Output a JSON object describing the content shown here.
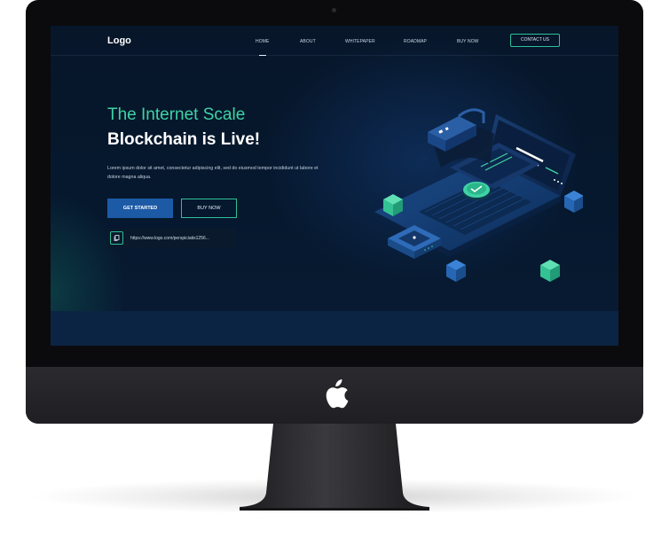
{
  "site": {
    "logo": "Logo",
    "nav": {
      "items": [
        "HOME",
        "ABOUT",
        "WHITEPAPER",
        "ROADMAP",
        "BUY NOW"
      ],
      "contact_label": "CONTACT US",
      "active_item": "HOME"
    },
    "hero": {
      "title_line1": "The Internet Scale",
      "title_line2": "Blockchain is Live!",
      "description": "Lorem ipsum dolor sit amet, consectetur adipiscing elit, sed do eiusmod tempor incididunt ut labore et dolore magna aliqua.",
      "primary_button": "GET STARTED",
      "secondary_button": "BUY NOW",
      "link_text": "https://www.logo.com/perspiciatis1256..."
    }
  },
  "colors": {
    "accent_green": "#3fd3a4",
    "primary_blue": "#1d5aa6",
    "screen_background": "#071629"
  },
  "icons": {
    "copy": "copy-icon",
    "device": "apple-logo-icon"
  }
}
